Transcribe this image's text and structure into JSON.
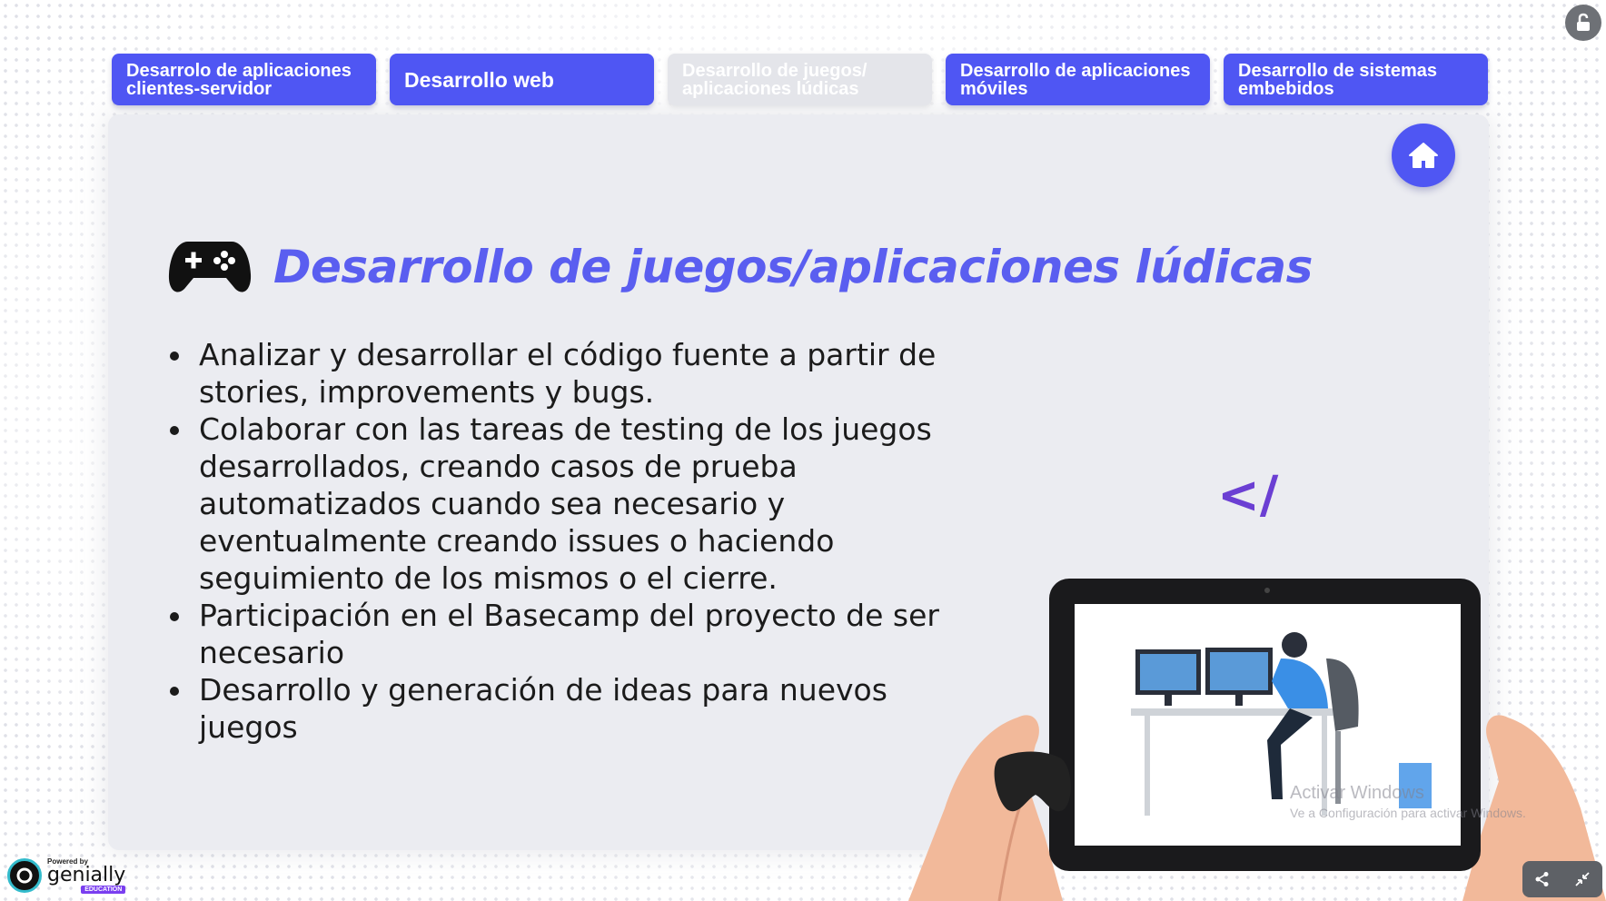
{
  "tabs": [
    {
      "label": "Desarrolo de aplicaciones clientes-servidor",
      "state": "active"
    },
    {
      "label": "Desarrollo web",
      "state": "active"
    },
    {
      "label": "Desarrollo de juegos/ aplicaciones lúdicas",
      "state": "current"
    },
    {
      "label": "Desarrollo de aplicaciones móviles",
      "state": "active"
    },
    {
      "label": "Desarrollo de sistemas embebidos",
      "state": "active"
    }
  ],
  "main": {
    "title": "Desarrollo de juegos/aplicaciones lúdicas",
    "title_icon": "gamepad-icon",
    "bullets": [
      "Analizar y desarrollar el código fuente a partir de stories, improvements y bugs.",
      "Colaborar con las tareas de testing de los juegos desarrollados, creando casos de prueba automatizados cuando sea necesario y eventualmente creando issues o haciendo seguimiento de los mismos o el cierre.",
      "Participación en el Basecamp del proyecto de ser necesario",
      "Desarrollo y generación de ideas para nuevos juegos"
    ],
    "code_glyph": "</"
  },
  "watermark": {
    "line1": "Activar Windows",
    "line2": "Ve a Configuración para activar Windows."
  },
  "branding": {
    "powered": "Powered by",
    "name": "genially",
    "edition": "EDUCATION"
  },
  "icons": {
    "home": "home-icon",
    "top_right": "lock-open-icon",
    "share": "share-icon",
    "exit_fullscreen": "exit-fullscreen-icon"
  },
  "colors": {
    "accent": "#4f56f3",
    "title": "#5a5ef0",
    "card_bg": "#ebecf1",
    "code_glyph": "#6b3fd3"
  }
}
